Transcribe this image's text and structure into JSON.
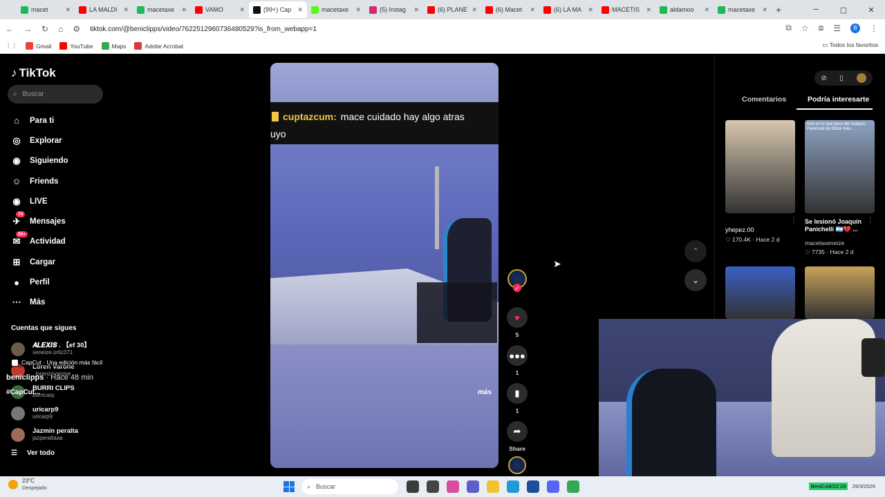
{
  "browser": {
    "tabs": [
      {
        "label": "macet",
        "icon": "green",
        "active": false
      },
      {
        "label": "LA MALDI",
        "icon": "youtube",
        "active": false
      },
      {
        "label": "macetaxe",
        "icon": "green",
        "active": false
      },
      {
        "label": "VAMO",
        "icon": "youtube",
        "active": false
      },
      {
        "label": "(99+) Cap",
        "icon": "tiktok",
        "active": true
      },
      {
        "label": "macetaxe",
        "icon": "kick",
        "active": false
      },
      {
        "label": "(5) Instag",
        "icon": "instagram",
        "active": false
      },
      {
        "label": "(6) PLANE",
        "icon": "youtube",
        "active": false
      },
      {
        "label": "(6) Macet",
        "icon": "youtube",
        "active": false
      },
      {
        "label": "(6) LA MA",
        "icon": "youtube",
        "active": false
      },
      {
        "label": "MACETIS",
        "icon": "youtube",
        "active": false
      },
      {
        "label": "aldamoo",
        "icon": "green",
        "active": false
      },
      {
        "label": "macetaxe",
        "icon": "green",
        "active": false
      }
    ],
    "new_tab": "+",
    "url": "tiktok.com/@beniclipps/video/7622512960736480529?is_from_webapp=1",
    "profile_initial": "B",
    "bookmarks": [
      "Gmail",
      "YouTube",
      "Maps",
      "Adobe Acrobat"
    ],
    "all_bookmarks": "Todos los favoritos"
  },
  "tiktok": {
    "logo": "TikTok",
    "search_placeholder": "Buscar",
    "nav": [
      {
        "label": "Para ti",
        "icon": "home-icon"
      },
      {
        "label": "Explorar",
        "icon": "compass-icon"
      },
      {
        "label": "Siguiendo",
        "icon": "following-icon"
      },
      {
        "label": "Friends",
        "icon": "friends-icon"
      },
      {
        "label": "LIVE",
        "icon": "live-icon"
      },
      {
        "label": "Mensajes",
        "icon": "messages-icon",
        "badge": "74"
      },
      {
        "label": "Actividad",
        "icon": "activity-icon",
        "badge": "99+"
      },
      {
        "label": "Cargar",
        "icon": "upload-icon"
      },
      {
        "label": "Perfil",
        "icon": "profile-icon"
      },
      {
        "label": "Más",
        "icon": "more-icon"
      }
    ],
    "following_title": "Cuentas que sigues",
    "following": [
      {
        "name": "𝑨𝑳𝑬𝑿𝑰𝑺 . 【ef 30】",
        "handle": "xeneize.ortiz371",
        "color": "#6b5b4b"
      },
      {
        "name": "Loren Varone",
        "handle": "_lorenzovarone",
        "color": "#c0392b"
      },
      {
        "name": "BURRI CLIPS",
        "handle": "burricarp",
        "color": "#3d6b3d"
      },
      {
        "name": "uricarp9",
        "handle": "uricarp9",
        "color": "#777777"
      },
      {
        "name": "Jazmin peralta",
        "handle": "jazperaltaaa",
        "color": "#a06a5a"
      }
    ],
    "see_all": "Ver todo",
    "video": {
      "chat_user": "cuptazcum:",
      "chat_line1": "mace cuidado hay algo atras",
      "chat_line2": "uyo",
      "capcut": "CapCut · Una edición más fácil",
      "author": "beniclipps",
      "time": " · Hace 48 min",
      "caption": "#CapCut...",
      "more": "más"
    },
    "actions": {
      "likes": "5",
      "comments": "1",
      "saves": "1",
      "share": "Share"
    },
    "right_panel": {
      "tab_comments": "Comentarios",
      "tab_interesting": "Podría interesarte",
      "items": [
        {
          "caption": "yhepez.00",
          "stats": "♡ 170.4K · Hace 2 d",
          "color": "#d8c7b0"
        },
        {
          "title": "Se lesionó Joaquín Panichelli 🇦🇷💔 ...",
          "caption": "macetaxeneize",
          "stats": "♡ 7735 · Hace 2 d",
          "overlay": "esto es lo que paso del Joaquín Panichelli de fútbol más...",
          "color": "#8ea4c4"
        },
        {
          "color": "#3a5fc4"
        },
        {
          "color": "#c9a35a"
        }
      ]
    }
  },
  "taskbar": {
    "weather_temp": "23°C",
    "weather_desc": "Despejado",
    "search": "Buscar",
    "tray_app": "BeniCA8/22:29",
    "date": "29/3/2026"
  }
}
